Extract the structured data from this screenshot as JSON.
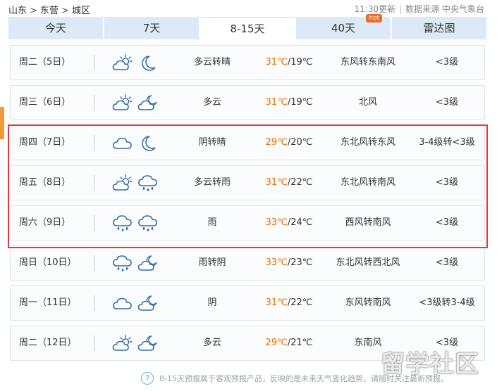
{
  "breadcrumb": {
    "province": "山东",
    "city": "东营",
    "district": "城区",
    "separator": ">"
  },
  "meta": {
    "updated": "11:30更新",
    "source": "数据来源 中央气象台"
  },
  "tabs": [
    {
      "label": "今天",
      "active": false
    },
    {
      "label": "7天",
      "active": false
    },
    {
      "label": "8-15天",
      "active": true
    },
    {
      "label": "40天",
      "active": false,
      "badge": "hot"
    },
    {
      "label": "雷达图",
      "active": false
    }
  ],
  "colors": {
    "accent_orange": "#f06a00",
    "highlight_red": "#e8343a",
    "tab_bg": "#dce9f6"
  },
  "forecast": [
    {
      "day": "周二（5日）",
      "icons": [
        "partly-cloudy-sun-icon",
        "moon-icon"
      ],
      "condition": "多云转晴",
      "high": "31℃",
      "low": "/19℃",
      "wind": "东风转东南风",
      "level": "<3级"
    },
    {
      "day": "周三（6日）",
      "icons": [
        "partly-cloudy-sun-icon",
        "partly-cloudy-moon-icon"
      ],
      "condition": "多云",
      "high": "31℃",
      "low": "/19℃",
      "wind": "北风",
      "level": "<3级"
    },
    {
      "day": "周四（7日）",
      "icons": [
        "cloud-icon",
        "moon-icon"
      ],
      "condition": "阴转晴",
      "high": "29℃",
      "low": "/20℃",
      "wind": "东北风转东风",
      "level": "3-4级转<3级"
    },
    {
      "day": "周五（8日）",
      "icons": [
        "partly-cloudy-sun-icon",
        "rain-cloud-icon"
      ],
      "condition": "多云转雨",
      "high": "31℃",
      "low": "/22℃",
      "wind": "东北风转南风",
      "level": "<3级"
    },
    {
      "day": "周六（9日）",
      "icons": [
        "rain-cloud-icon",
        "rain-cloud-icon"
      ],
      "condition": "雨",
      "high": "33℃",
      "low": "/24℃",
      "wind": "西风转南风",
      "level": "<3级"
    },
    {
      "day": "周日（10日）",
      "icons": [
        "rain-cloud-icon",
        "partly-cloudy-moon-icon"
      ],
      "condition": "雨转阴",
      "high": "33℃",
      "low": "/23℃",
      "wind": "东北风转西北风",
      "level": "<3级"
    },
    {
      "day": "周一（11日）",
      "icons": [
        "cloud-icon",
        "partly-cloudy-moon-icon"
      ],
      "condition": "阴",
      "high": "31℃",
      "low": "/22℃",
      "wind": "东风转南风",
      "level": "<3级转3-4级"
    },
    {
      "day": "周二（12日）",
      "icons": [
        "partly-cloudy-sun-icon",
        "partly-cloudy-moon-icon"
      ],
      "condition": "多云",
      "high": "29℃",
      "low": "/21℃",
      "wind": "东南风",
      "level": "<3级"
    }
  ],
  "footer": {
    "help_icon": "?",
    "text": "8-15天预报属于客观预报产品，反映的是未来天气变化趋势，请随时关注最新预报。"
  },
  "watermark": "留学社区"
}
